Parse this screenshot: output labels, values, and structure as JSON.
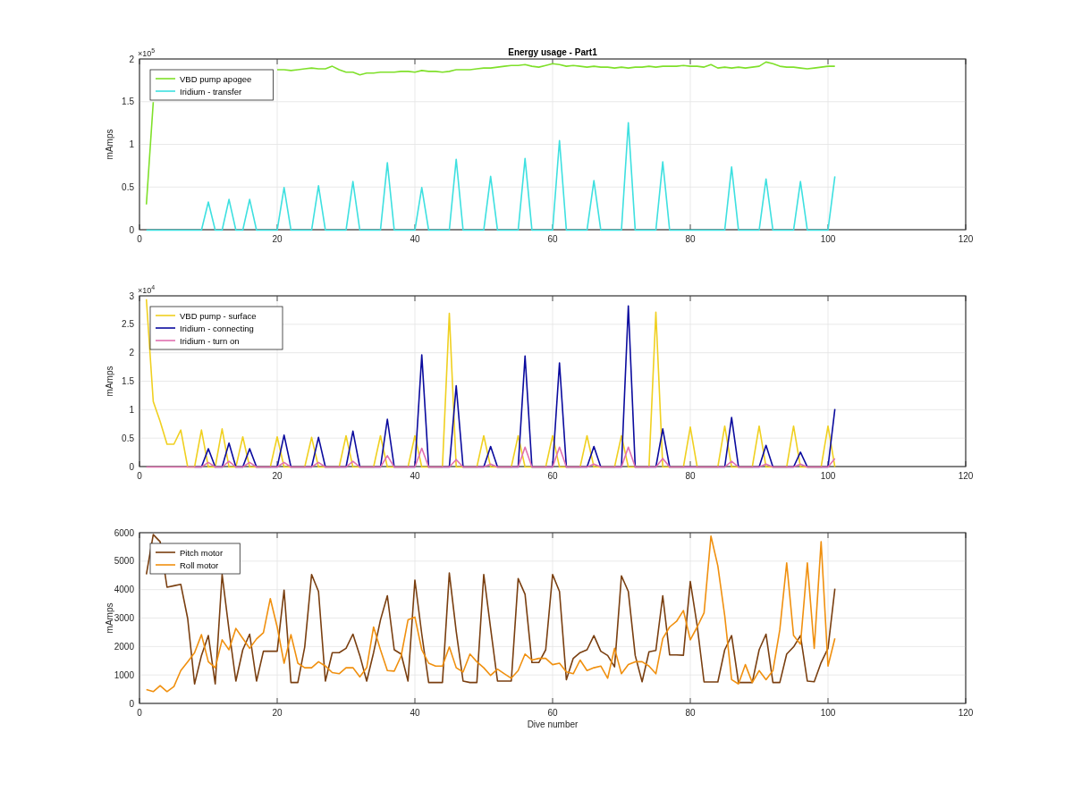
{
  "figure": {
    "panels": [
      {
        "multiplier": {
          "base": "×10",
          "exponent": "5"
        },
        "chart_data": {
          "type": "line",
          "grid": true,
          "legend": true,
          "title": "Energy usage - Part1",
          "ylabel": "mAmps",
          "xlim": [
            0,
            120
          ],
          "ylim": [
            0,
            2
          ],
          "xticks": [
            0,
            20,
            40,
            60,
            80,
            100,
            120
          ],
          "yticks": [
            0,
            0.5,
            1,
            1.5,
            2
          ],
          "x": [
            1,
            2,
            3,
            4,
            5,
            6,
            7,
            8,
            9,
            10,
            11,
            12,
            13,
            14,
            15,
            16,
            17,
            18,
            19,
            20,
            21,
            22,
            23,
            24,
            25,
            26,
            27,
            28,
            29,
            30,
            31,
            32,
            33,
            34,
            35,
            36,
            37,
            38,
            39,
            40,
            41,
            42,
            43,
            44,
            45,
            46,
            47,
            48,
            49,
            50,
            51,
            52,
            53,
            54,
            55,
            56,
            57,
            58,
            59,
            60,
            61,
            62,
            63,
            64,
            65,
            66,
            67,
            68,
            69,
            70,
            71,
            72,
            73,
            74,
            75,
            76,
            77,
            78,
            79,
            80,
            81,
            82,
            83,
            84,
            85,
            86,
            87,
            88,
            89,
            90,
            91,
            92,
            93,
            94,
            95,
            96,
            97,
            98,
            99,
            100,
            101
          ],
          "series": [
            {
              "name": "VBD pump apogee",
              "color": "#7fe02a",
              "values": [
                0.3,
                1.5,
                null,
                null,
                null,
                null,
                null,
                null,
                null,
                null,
                null,
                null,
                null,
                null,
                null,
                null,
                null,
                null,
                null,
                1.88,
                1.88,
                1.87,
                1.88,
                1.89,
                1.9,
                1.89,
                1.89,
                1.92,
                1.88,
                1.85,
                1.85,
                1.82,
                1.84,
                1.84,
                1.85,
                1.85,
                1.85,
                1.86,
                1.86,
                1.85,
                1.87,
                1.86,
                1.86,
                1.85,
                1.86,
                1.88,
                1.88,
                1.88,
                1.89,
                1.9,
                1.9,
                1.91,
                1.92,
                1.93,
                1.93,
                1.94,
                1.92,
                1.91,
                1.93,
                1.95,
                1.94,
                1.92,
                1.93,
                1.92,
                1.91,
                1.92,
                1.91,
                1.91,
                1.9,
                1.91,
                1.9,
                1.91,
                1.91,
                1.92,
                1.91,
                1.92,
                1.92,
                1.92,
                1.93,
                1.92,
                1.92,
                1.91,
                1.94,
                1.9,
                1.91,
                1.9,
                1.91,
                1.9,
                1.91,
                1.92,
                1.97,
                1.95,
                1.92,
                1.91,
                1.91,
                1.9,
                1.89,
                1.9,
                1.91,
                1.92,
                1.92
              ]
            },
            {
              "name": "Iridium - transfer",
              "color": "#3ee0e0",
              "values": [
                0,
                0,
                0,
                0,
                0,
                0,
                0,
                0,
                0,
                0.33,
                0,
                0,
                0.36,
                0,
                0,
                0.36,
                0,
                0,
                0,
                0,
                0.5,
                0,
                0,
                0,
                0,
                0.52,
                0,
                0,
                0,
                0,
                0.57,
                0,
                0,
                0,
                0,
                0.79,
                0,
                0,
                0,
                0,
                0.5,
                0,
                0,
                0,
                0,
                0.83,
                0,
                0,
                0,
                0,
                0.63,
                0,
                0,
                0,
                0,
                0.84,
                0,
                0,
                0,
                0,
                1.05,
                0,
                0,
                0,
                0,
                0.58,
                0,
                0,
                0,
                0,
                1.26,
                0,
                0,
                0,
                0,
                0.8,
                0,
                0,
                0,
                0,
                0,
                0,
                0,
                0,
                0,
                0.74,
                0,
                0,
                0,
                0,
                0.6,
                0,
                0,
                0,
                0,
                0.57,
                0,
                0,
                0,
                0,
                0.63
              ]
            }
          ]
        }
      },
      {
        "multiplier": {
          "base": "×10",
          "exponent": "4"
        },
        "chart_data": {
          "type": "line",
          "grid": true,
          "legend": true,
          "ylabel": "mAmps",
          "xlim": [
            0,
            120
          ],
          "ylim": [
            0,
            3
          ],
          "xticks": [
            0,
            20,
            40,
            60,
            80,
            100,
            120
          ],
          "yticks": [
            0,
            0.5,
            1,
            1.5,
            2,
            2.5,
            3
          ],
          "x": [
            1,
            2,
            3,
            4,
            5,
            6,
            7,
            8,
            9,
            10,
            11,
            12,
            13,
            14,
            15,
            16,
            17,
            18,
            19,
            20,
            21,
            22,
            23,
            24,
            25,
            26,
            27,
            28,
            29,
            30,
            31,
            32,
            33,
            34,
            35,
            36,
            37,
            38,
            39,
            40,
            41,
            42,
            43,
            44,
            45,
            46,
            47,
            48,
            49,
            50,
            51,
            52,
            53,
            54,
            55,
            56,
            57,
            58,
            59,
            60,
            61,
            62,
            63,
            64,
            65,
            66,
            67,
            68,
            69,
            70,
            71,
            72,
            73,
            74,
            75,
            76,
            77,
            78,
            79,
            80,
            81,
            82,
            83,
            84,
            85,
            86,
            87,
            88,
            89,
            90,
            91,
            92,
            93,
            94,
            95,
            96,
            97,
            98,
            99,
            100,
            101
          ],
          "series": [
            {
              "name": "VBD pump - surface",
              "color": "#f0d020",
              "values": [
                2.95,
                1.15,
                0.8,
                0.4,
                0.4,
                0.65,
                0,
                0,
                0.65,
                0,
                0,
                0.67,
                0,
                0,
                0.53,
                0,
                0,
                0,
                0,
                0.53,
                0,
                0,
                0,
                0,
                0.52,
                0,
                0,
                0,
                0,
                0.55,
                0,
                0,
                0,
                0,
                0.55,
                0,
                0,
                0,
                0,
                0.55,
                0,
                0,
                0,
                0,
                2.7,
                0,
                0,
                0,
                0,
                0.55,
                0,
                0,
                0,
                0,
                0.55,
                0,
                0,
                0,
                0,
                0.55,
                0,
                0,
                0,
                0,
                0.55,
                0,
                0,
                0,
                0,
                0.55,
                0,
                0,
                0,
                0,
                2.72,
                0,
                0,
                0,
                0,
                0.7,
                0,
                0,
                0,
                0,
                0.72,
                0,
                0,
                0,
                0,
                0.72,
                0,
                0,
                0,
                0,
                0.72,
                0,
                0,
                0,
                0,
                0.72,
                0
              ]
            },
            {
              "name": "Iridium - connecting",
              "color": "#0b0b9e",
              "values": [
                null,
                null,
                null,
                null,
                null,
                null,
                null,
                0,
                0,
                0.32,
                0,
                0,
                0.42,
                0,
                0,
                0.32,
                0,
                0,
                0,
                0,
                0.56,
                0,
                0,
                0,
                0,
                0.52,
                0,
                0,
                0,
                0,
                0.63,
                0,
                0,
                0,
                0,
                0.84,
                0,
                0,
                0,
                0,
                1.97,
                0,
                0,
                0,
                0,
                1.43,
                0,
                0,
                0,
                0,
                0.36,
                0,
                0,
                0,
                0,
                1.95,
                0,
                0,
                0,
                0,
                1.83,
                0,
                0,
                0,
                0,
                0.36,
                0,
                0,
                0,
                0,
                2.83,
                0,
                0,
                0,
                0,
                0.67,
                0,
                0,
                0,
                0,
                0,
                0,
                0,
                0,
                0,
                0.87,
                0,
                0,
                0,
                0,
                0.38,
                0,
                0,
                0,
                0,
                0.26,
                0,
                0,
                0,
                0,
                1.02
              ]
            },
            {
              "name": "Iridium - turn on",
              "color": "#e070b0",
              "values": [
                0,
                0,
                0,
                0,
                0,
                0,
                0,
                0,
                0,
                0.08,
                0,
                0,
                0.1,
                0,
                0,
                0.08,
                0,
                0,
                0,
                0,
                0.08,
                0,
                0,
                0,
                0,
                0.08,
                0,
                0,
                0,
                0,
                0.1,
                0,
                0,
                0,
                0,
                0.2,
                0,
                0,
                0,
                0,
                0.33,
                0,
                0,
                0,
                0,
                0.13,
                0,
                0,
                0,
                0,
                0.05,
                0,
                0,
                0,
                0,
                0.35,
                0,
                0,
                0,
                0,
                0.35,
                0,
                0,
                0,
                0,
                0.05,
                0,
                0,
                0,
                0,
                0.35,
                0,
                0,
                0,
                0,
                0.15,
                0,
                0,
                0,
                0,
                0,
                0,
                0,
                0,
                0,
                0.1,
                0,
                0,
                0,
                0,
                0.05,
                0,
                0,
                0,
                0,
                0.05,
                0,
                0,
                0,
                0,
                0.15
              ]
            }
          ]
        }
      },
      {
        "chart_data": {
          "type": "line",
          "grid": true,
          "legend": true,
          "xlabel": "Dive number",
          "ylabel": "mAmps",
          "xlim": [
            0,
            120
          ],
          "ylim": [
            0,
            6000
          ],
          "xticks": [
            0,
            20,
            40,
            60,
            80,
            100,
            120
          ],
          "yticks": [
            0,
            1000,
            2000,
            3000,
            4000,
            5000,
            6000
          ],
          "x": [
            1,
            2,
            3,
            4,
            5,
            6,
            7,
            8,
            9,
            10,
            11,
            12,
            13,
            14,
            15,
            16,
            17,
            18,
            19,
            20,
            21,
            22,
            23,
            24,
            25,
            26,
            27,
            28,
            29,
            30,
            31,
            32,
            33,
            34,
            35,
            36,
            37,
            38,
            39,
            40,
            41,
            42,
            43,
            44,
            45,
            46,
            47,
            48,
            49,
            50,
            51,
            52,
            53,
            54,
            55,
            56,
            57,
            58,
            59,
            60,
            61,
            62,
            63,
            64,
            65,
            66,
            67,
            68,
            69,
            70,
            71,
            72,
            73,
            74,
            75,
            76,
            77,
            78,
            79,
            80,
            81,
            82,
            83,
            84,
            85,
            86,
            87,
            88,
            89,
            90,
            91,
            92,
            93,
            94,
            95,
            96,
            97,
            98,
            99,
            100,
            101
          ],
          "series": [
            {
              "name": "Pitch motor",
              "color": "#7a3f10",
              "values": [
                4550,
                5950,
                5700,
                4100,
                4150,
                4200,
                3000,
                700,
                1700,
                2400,
                700,
                4550,
                2600,
                800,
                1900,
                2450,
                800,
                1850,
                1850,
                1850,
                4000,
                750,
                750,
                2000,
                4550,
                3950,
                800,
                1800,
                1800,
                1950,
                2450,
                1700,
                800,
                1800,
                2950,
                3800,
                1900,
                1750,
                800,
                4350,
                2450,
                750,
                750,
                750,
                4600,
                2550,
                800,
                750,
                750,
                4550,
                2650,
                800,
                800,
                800,
                4400,
                3850,
                1450,
                1450,
                1900,
                4550,
                3950,
                850,
                1600,
                1800,
                1900,
                2400,
                1850,
                1700,
                1300,
                4500,
                3950,
                1700,
                780,
                1830,
                1880,
                3800,
                1720,
                1720,
                1710,
                4300,
                2750,
                770,
                770,
                770,
                1900,
                2400,
                750,
                750,
                750,
                1900,
                2450,
                750,
                750,
                1750,
                2000,
                2400,
                800,
                780,
                1450,
                1950,
                4050
              ]
            },
            {
              "name": "Roll motor",
              "color": "#f0900f",
              "values": [
                500,
                430,
                640,
                430,
                610,
                1170,
                1480,
                1800,
                2430,
                1480,
                1270,
                2250,
                1900,
                2650,
                2300,
                1950,
                2280,
                2500,
                3700,
                2700,
                1430,
                2430,
                1430,
                1270,
                1270,
                1480,
                1330,
                1100,
                1060,
                1270,
                1270,
                950,
                1270,
                2700,
                1900,
                1170,
                1150,
                1680,
                2950,
                3050,
                1900,
                1430,
                1330,
                1330,
                2000,
                1270,
                1120,
                1750,
                1480,
                1270,
                1000,
                1220,
                1060,
                900,
                1170,
                1750,
                1540,
                1600,
                1600,
                1380,
                1430,
                1120,
                1060,
                1540,
                1170,
                1270,
                1330,
                900,
                1950,
                1060,
                1380,
                1480,
                1480,
                1330,
                1060,
                2300,
                2700,
                2900,
                3280,
                2250,
                2700,
                3200,
                5900,
                4850,
                3100,
                850,
                700,
                1380,
                750,
                1170,
                850,
                1170,
                2600,
                4950,
                2400,
                2100,
                4950,
                1950,
                5700,
                1330,
                2300
              ]
            }
          ]
        }
      }
    ]
  }
}
